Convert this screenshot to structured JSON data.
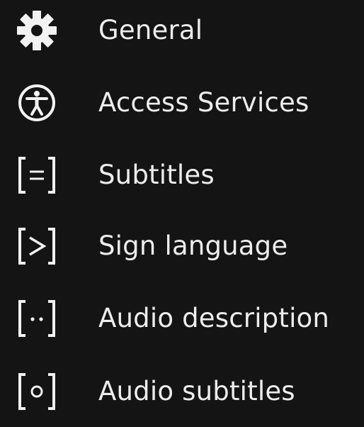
{
  "menu": {
    "items": [
      {
        "label": "General",
        "icon": "gear-icon"
      },
      {
        "label": "Access Services",
        "icon": "accessibility-icon"
      },
      {
        "label": "Subtitles",
        "icon": "subtitles-icon"
      },
      {
        "label": "Sign language",
        "icon": "sign-language-icon"
      },
      {
        "label": "Audio description",
        "icon": "audio-description-icon"
      },
      {
        "label": "Audio subtitles",
        "icon": "audio-subtitles-icon"
      }
    ]
  }
}
